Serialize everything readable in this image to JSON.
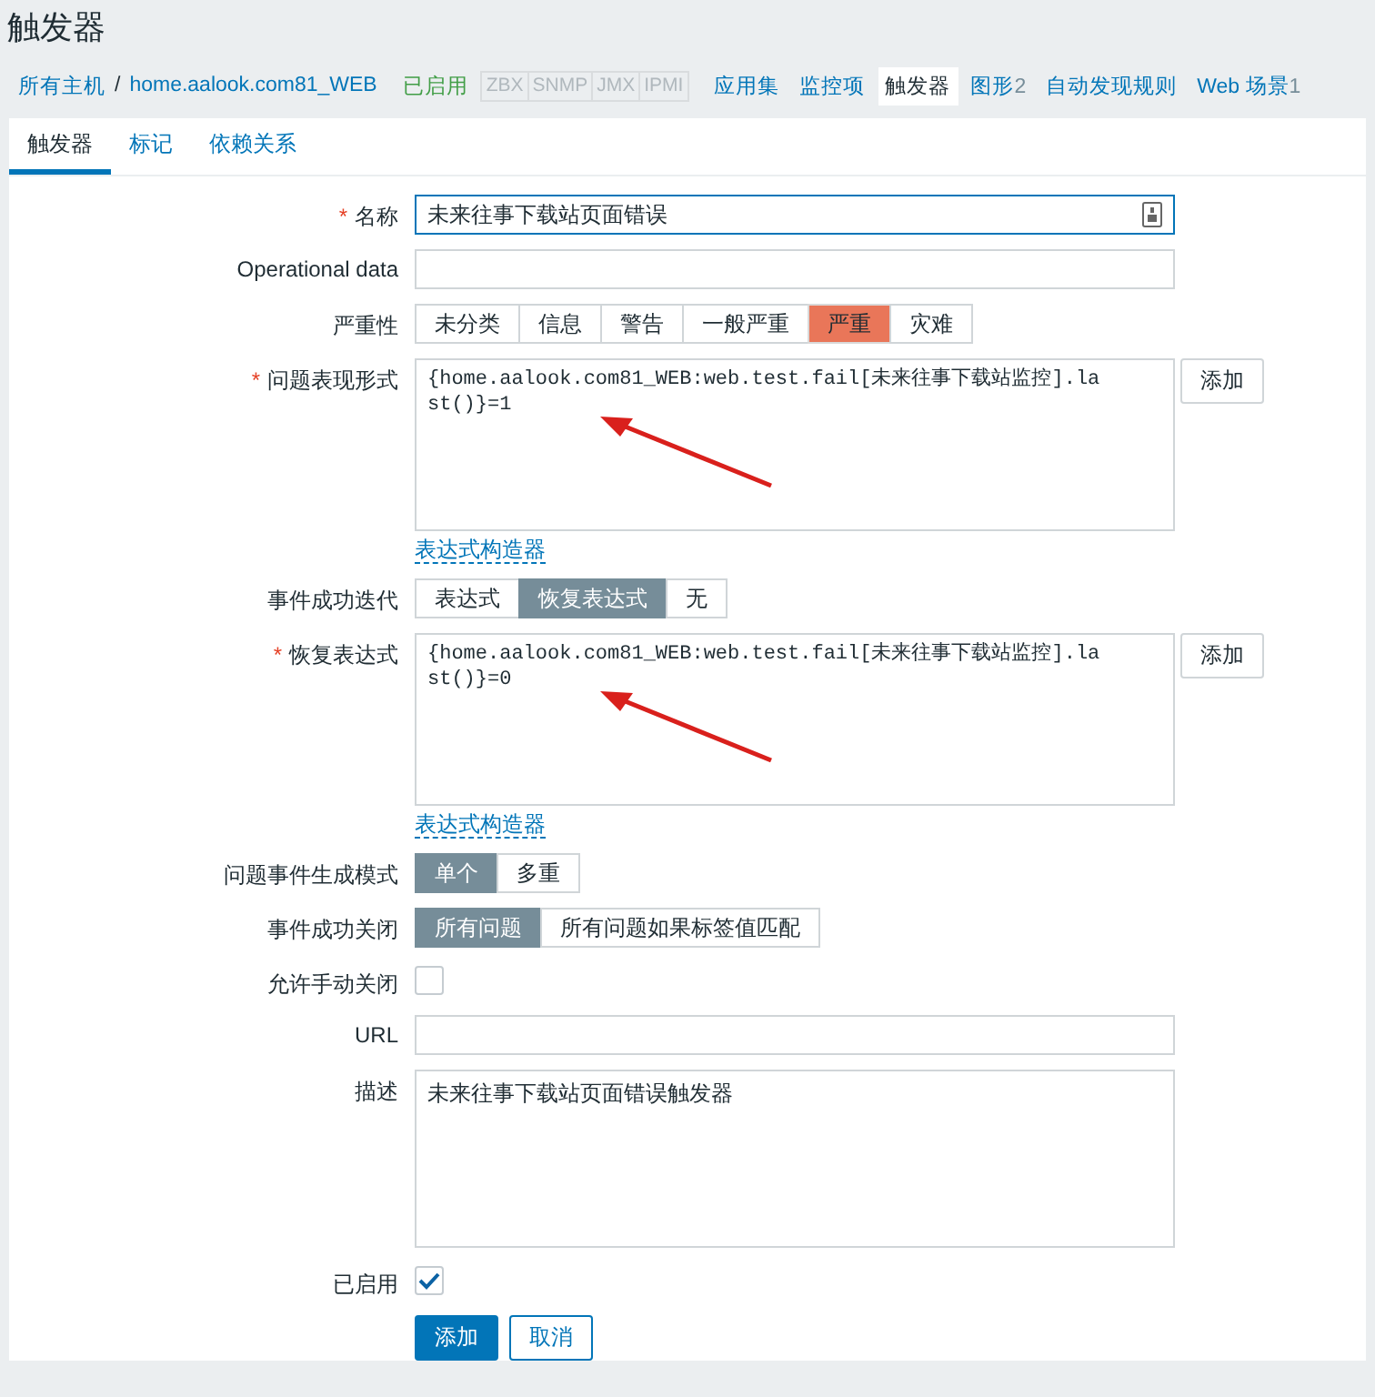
{
  "page_title": "触发器",
  "breadcrumb": {
    "items": [
      "所有主机",
      "home.aalook.com81_WEB"
    ],
    "separator": "/",
    "status": "已启用",
    "availability": [
      "ZBX",
      "SNMP",
      "JMX",
      "IPMI"
    ],
    "links": [
      {
        "label": "应用集",
        "selected": false
      },
      {
        "label": "监控项",
        "selected": false
      },
      {
        "label": "触发器",
        "selected": true
      },
      {
        "label": "图形",
        "count": "2",
        "selected": false
      },
      {
        "label": "自动发现规则",
        "selected": false
      },
      {
        "label": "Web 场景",
        "count": "1",
        "selected": false
      }
    ]
  },
  "tabs": [
    {
      "label": "触发器",
      "selected": true
    },
    {
      "label": "标记",
      "selected": false
    },
    {
      "label": "依赖关系",
      "selected": false
    }
  ],
  "form": {
    "required_mark": "*",
    "fields": [
      {
        "kind": "text",
        "label": "名称",
        "required": true,
        "value": "未来往事下载站页面错误",
        "focused": true
      },
      {
        "kind": "text",
        "label": "Operational data",
        "required": false
      },
      {
        "kind": "severity",
        "label": "严重性",
        "options": [
          {
            "label": "未分类",
            "selected": false
          },
          {
            "label": "信息",
            "selected": false
          },
          {
            "label": "警告",
            "selected": false
          },
          {
            "label": "一般严重",
            "selected": false
          },
          {
            "label": "严重",
            "selected": true
          },
          {
            "label": "灾难",
            "selected": false
          }
        ]
      },
      {
        "kind": "expression",
        "label": "问题表现形式",
        "required": true,
        "value": "{home.aalook.com81_WEB:web.test.fail[未来往事下载站监控].last()}=1",
        "button": "添加",
        "link": "表达式构造器",
        "arrow": true
      },
      {
        "kind": "segmented",
        "label": "事件成功迭代",
        "options": [
          {
            "label": "表达式",
            "selected": false
          },
          {
            "label": "恢复表达式",
            "selected": true
          },
          {
            "label": "无",
            "selected": false
          }
        ]
      },
      {
        "kind": "expression",
        "label": "恢复表达式",
        "required": true,
        "value": "{home.aalook.com81_WEB:web.test.fail[未来往事下载站监控].last()}=0",
        "button": "添加",
        "link": "表达式构造器",
        "arrow": true
      },
      {
        "kind": "segmented",
        "label": "问题事件生成模式",
        "options": [
          {
            "label": "单个",
            "selected": true
          },
          {
            "label": "多重",
            "selected": false
          }
        ]
      },
      {
        "kind": "segmented",
        "label": "事件成功关闭",
        "options": [
          {
            "label": "所有问题",
            "selected": true
          },
          {
            "label": "所有问题如果标签值匹配",
            "selected": false
          }
        ]
      },
      {
        "kind": "checkbox",
        "label": "允许手动关闭",
        "checked": false
      },
      {
        "kind": "text",
        "label": "URL",
        "required": false
      },
      {
        "kind": "textarea",
        "label": "描述",
        "value": "未来往事下载站页面错误触发器"
      },
      {
        "kind": "checkbox",
        "label": "已启用",
        "checked": true
      }
    ],
    "buttons": [
      {
        "label": "添加",
        "kind": "primary"
      },
      {
        "label": "取消",
        "kind": "secondary"
      }
    ]
  }
}
